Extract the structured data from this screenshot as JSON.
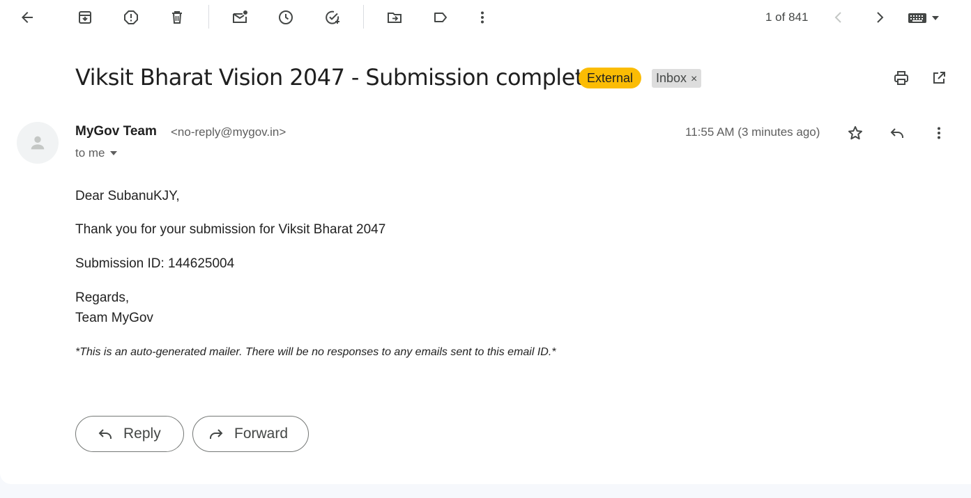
{
  "toolbar": {
    "icons": [
      "back-arrow-icon",
      "archive-icon",
      "report-spam-icon",
      "delete-icon",
      "mark-unread-icon",
      "snooze-icon",
      "add-to-tasks-icon",
      "move-to-icon",
      "label-icon",
      "more-vert-icon"
    ],
    "counter": "1 of 841"
  },
  "message": {
    "subject": "Viksit Bharat Vision 2047 - Submission complete",
    "labels": {
      "external": "External",
      "inbox": "Inbox",
      "inbox_remove": "×"
    },
    "sender_name": "MyGov Team",
    "sender_email": "<no-reply@mygov.in>",
    "recipient": "to me",
    "time": "11:55 AM (3 minutes ago)",
    "body": {
      "greeting": "Dear SubanuKJY,",
      "line1": "Thank you for your submission for Viksit Bharat 2047",
      "line2": "Submission ID: 144625004",
      "regards": "Regards,",
      "signature": "Team MyGov",
      "note": "*This is an auto-generated mailer. There will be no responses to any emails sent to this email ID.*"
    }
  },
  "actions": {
    "reply": "Reply",
    "forward": "Forward"
  },
  "colors": {
    "external_badge": "#fbbc04",
    "inbox_badge": "#dddddd",
    "icon": "#444746",
    "background": "#f6f8fc"
  }
}
